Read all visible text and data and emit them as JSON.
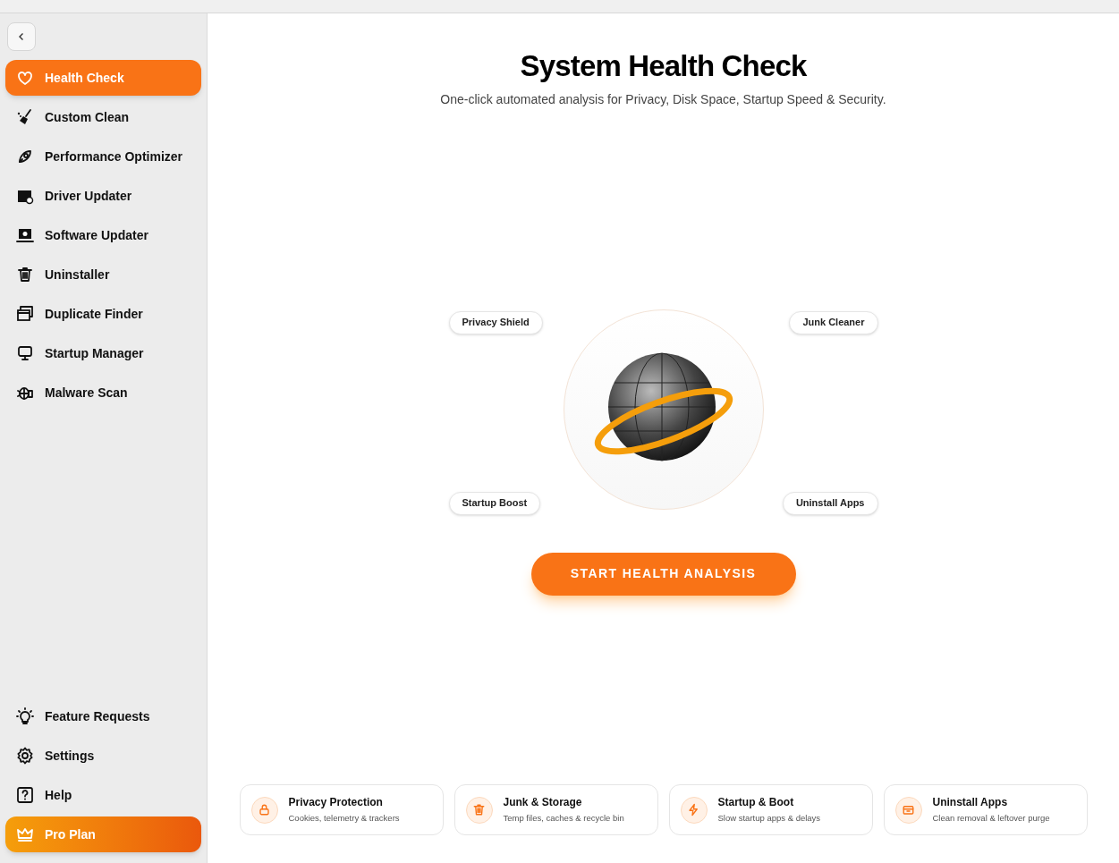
{
  "sidebar": {
    "items": [
      {
        "label": "Health Check",
        "selected": true
      },
      {
        "label": "Custom Clean",
        "selected": false
      },
      {
        "label": "Performance Optimizer",
        "selected": false
      },
      {
        "label": "Driver Updater",
        "selected": false
      },
      {
        "label": "Software Updater",
        "selected": false
      },
      {
        "label": "Uninstaller",
        "selected": false
      },
      {
        "label": "Duplicate Finder",
        "selected": false
      },
      {
        "label": "Startup Manager",
        "selected": false
      },
      {
        "label": "Malware Scan",
        "selected": false
      }
    ],
    "bottom_items": [
      {
        "label": "Feature Requests"
      },
      {
        "label": "Settings"
      },
      {
        "label": "Help"
      }
    ],
    "pro_plan": {
      "label": "Pro Plan"
    }
  },
  "main": {
    "title": "System Health Check",
    "subtitle": "One-click automated analysis for Privacy, Disk Space, Startup Speed & Security.",
    "feature_pills": [
      "Privacy Shield",
      "Junk Cleaner",
      "Startup Boost",
      "Uninstall Apps"
    ],
    "start_button": "START HEALTH ANALYSIS",
    "cards": [
      {
        "title": "Privacy Protection",
        "description": "Cookies, telemetry & trackers"
      },
      {
        "title": "Junk & Storage",
        "description": "Temp files, caches & recycle bin"
      },
      {
        "title": "Startup & Boot",
        "description": "Slow startup apps & delays"
      },
      {
        "title": "Uninstall Apps",
        "description": "Clean removal & leftover purge"
      }
    ]
  }
}
